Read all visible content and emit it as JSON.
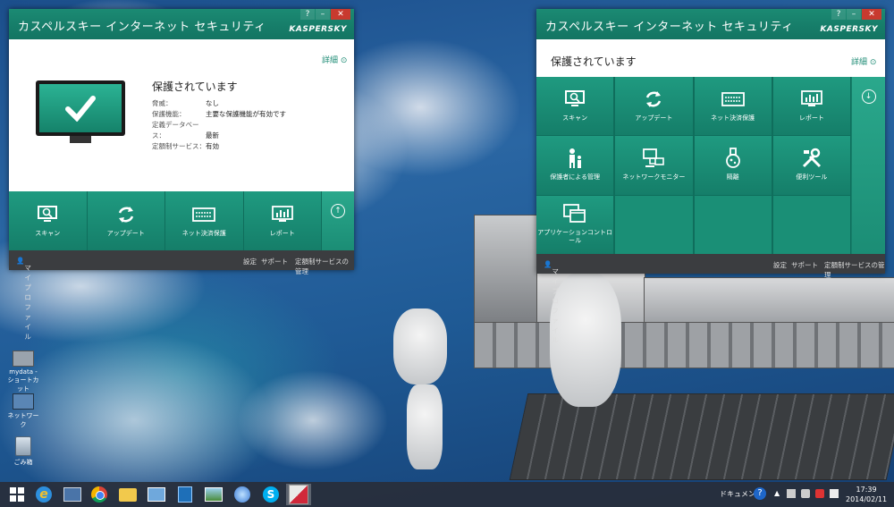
{
  "left_window": {
    "title": "カスペルスキー インターネット セキュリティ",
    "brand": "KASPERSKY",
    "detail_link": "詳細",
    "status_heading": "保護されています",
    "status_rows": [
      {
        "label": "脅威：",
        "value": "なし"
      },
      {
        "label": "保護機能：",
        "value": "主要な保護機能が有効です"
      },
      {
        "label": "定義データベース：",
        "value": "最新"
      },
      {
        "label": "定額制サービス：",
        "value": "有効"
      }
    ],
    "tiles": [
      {
        "label": "スキャン",
        "icon": "scan-monitor-icon"
      },
      {
        "label": "アップデート",
        "icon": "update-arrows-icon"
      },
      {
        "label": "ネット決済保護",
        "icon": "card-icon"
      },
      {
        "label": "レポート",
        "icon": "report-chart-icon"
      }
    ],
    "footer": {
      "profile": "マイプロファイル",
      "settings": "設定",
      "support": "サポート",
      "subscription": "定額制サービスの管理"
    }
  },
  "right_window": {
    "title": "カスペルスキー インターネット セキュリティ",
    "brand": "KASPERSKY",
    "status_heading": "保護されています",
    "detail_link": "詳細",
    "tiles": [
      {
        "label": "スキャン",
        "icon": "scan-monitor-icon"
      },
      {
        "label": "アップデート",
        "icon": "update-arrows-icon"
      },
      {
        "label": "ネット決済保護",
        "icon": "card-icon"
      },
      {
        "label": "レポート",
        "icon": "report-chart-icon"
      },
      {
        "label": "保護者による管理",
        "icon": "family-icon"
      },
      {
        "label": "ネットワークモニター",
        "icon": "network-icon"
      },
      {
        "label": "隔離",
        "icon": "flask-icon"
      },
      {
        "label": "便利ツール",
        "icon": "tools-icon"
      },
      {
        "label": "アプリケーションコントロール",
        "icon": "windows-icon"
      }
    ],
    "footer": {
      "profile": "マイプロファイル",
      "settings": "設定",
      "support": "サポート",
      "subscription": "定額制サービスの管理"
    }
  },
  "window_controls": {
    "help": "?",
    "minimize": "–",
    "close": "✕"
  },
  "desktop_icons": [
    {
      "label": "mydata - ショートカット",
      "icon": "network-drive-icon"
    },
    {
      "label": "ネットワーク",
      "icon": "network-computer-icon"
    },
    {
      "label": "ごみ箱",
      "icon": "recycle-bin-icon"
    }
  ],
  "taskbar": {
    "apps": [
      "start-icon",
      "ie-icon",
      "chrome-icon",
      "explorer-icon",
      "remote-desktop-icon",
      "media-icon",
      "photos-icon",
      "itunes-icon",
      "skype-icon",
      "kaspersky-icon"
    ],
    "toolbar_label": "ドキュメント",
    "time": "17:39",
    "date": "2014/02/11"
  },
  "colors": {
    "accent": "#1b8a73",
    "footer": "#3b3d40",
    "taskbar": "#282e3a"
  }
}
